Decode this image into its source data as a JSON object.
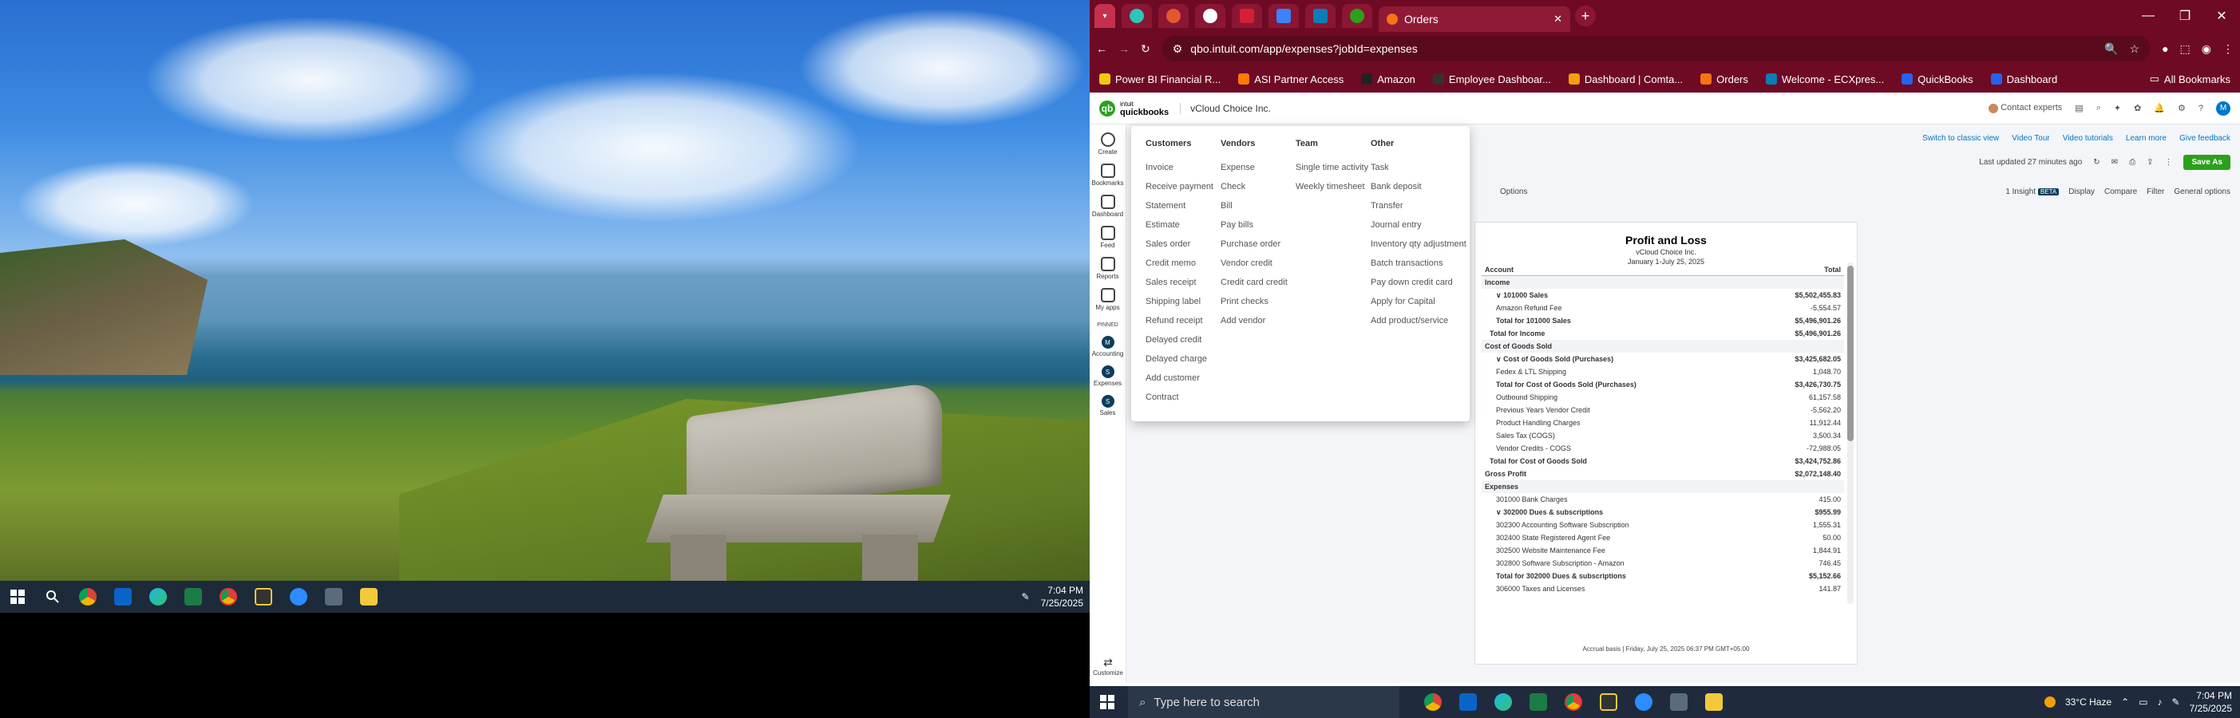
{
  "left_monitor": {
    "taskbar": {
      "icons": [
        "windows-start-icon",
        "search-icon",
        "chrome-icon",
        "outlook-icon",
        "edge-icon",
        "excel-icon",
        "chrome-profile-icon",
        "sticky-icon",
        "zoom-icon",
        "calculator-icon",
        "file-explorer-icon"
      ],
      "time": "7:04 PM",
      "date": "7/25/2025"
    }
  },
  "browser": {
    "active_tab_title": "Orders",
    "url": "qbo.intuit.com/app/expenses?jobId=expenses",
    "bookmarks": [
      "Power BI Financial R...",
      "ASI Partner Access",
      "Amazon",
      "Employee Dashboar...",
      "Dashboard | Comta...",
      "Orders",
      "Welcome - ECXpres...",
      "QuickBooks",
      "Dashboard"
    ],
    "all_bookmarks": "All Bookmarks"
  },
  "qbo": {
    "logo_top": "intuit",
    "logo_bottom": "quickbooks",
    "company": "vCloud Choice Inc.",
    "contact_experts": "Contact experts",
    "avatar": "M",
    "nav": [
      {
        "label": "Create"
      },
      {
        "label": "Bookmarks"
      },
      {
        "label": "Dashboard"
      },
      {
        "label": "Feed"
      },
      {
        "label": "Reports"
      },
      {
        "label": "My apps"
      }
    ],
    "pinned_label": "PINNED",
    "pinned": [
      {
        "label": "Accounting",
        "letter": "M"
      },
      {
        "label": "Expenses",
        "letter": "S"
      },
      {
        "label": "Sales",
        "letter": "S"
      }
    ],
    "customize": "Customize",
    "create_menu": {
      "customers": {
        "head": "Customers",
        "items": [
          "Invoice",
          "Receive payment",
          "Statement",
          "Estimate",
          "Sales order",
          "Credit memo",
          "Sales receipt",
          "Shipping label",
          "Refund receipt",
          "Delayed credit",
          "Delayed charge",
          "Add customer",
          "Contract"
        ]
      },
      "vendors": {
        "head": "Vendors",
        "items": [
          "Expense",
          "Check",
          "Bill",
          "Pay bills",
          "Purchase order",
          "Vendor credit",
          "Credit card credit",
          "Print checks",
          "Add vendor"
        ]
      },
      "team": {
        "head": "Team",
        "items": [
          "Single time activity",
          "Weekly timesheet"
        ]
      },
      "other": {
        "head": "Other",
        "items": [
          "Task",
          "Bank deposit",
          "Transfer",
          "Journal entry",
          "Inventory qty adjustment",
          "Batch transactions",
          "Pay down credit card",
          "Apply for Capital",
          "Add product/service"
        ]
      }
    },
    "toolbar": {
      "switch_classic": "Switch to classic view",
      "video_tour": "Video Tour",
      "video_tutorials": "Video tutorials",
      "learn_more": "Learn more",
      "give_feedback": "Give feedback",
      "last_updated": "Last updated 27 minutes ago",
      "save_as": "Save As",
      "options": "Options",
      "insight": "1 Insight",
      "insight_badge": "BETA",
      "display": "Display",
      "compare": "Compare",
      "filter": "Filter",
      "general_options": "General options"
    },
    "report": {
      "title": "Profit and Loss",
      "company": "vCloud Choice Inc.",
      "period": "January 1-July 25, 2025",
      "col_account": "Account",
      "col_total": "Total",
      "rows": [
        {
          "label": "Income",
          "value": "",
          "style": "sec"
        },
        {
          "label": "∨ 101000 Sales",
          "value": "$5,502,455.83",
          "style": "b"
        },
        {
          "label": "Amazon Refund Fee",
          "value": "-5,554.57",
          "style": ""
        },
        {
          "label": "Total for 101000 Sales",
          "value": "$5,496,901.26",
          "style": "b"
        },
        {
          "label": "Total for Income",
          "value": "$5,496,901.26",
          "style": "b"
        },
        {
          "label": "Cost of Goods Sold",
          "value": "",
          "style": "sec"
        },
        {
          "label": "∨ Cost of Goods Sold (Purchases)",
          "value": "$3,425,682.05",
          "style": "b"
        },
        {
          "label": "Fedex & LTL Shipping",
          "value": "1,048.70",
          "style": ""
        },
        {
          "label": "Total for Cost of Goods Sold (Purchases)",
          "value": "$3,426,730.75",
          "style": "b"
        },
        {
          "label": "Outbound Shipping",
          "value": "61,157.58",
          "style": ""
        },
        {
          "label": "Previous Years Vendor Credit",
          "value": "-5,562.20",
          "style": ""
        },
        {
          "label": "Product Handling Charges",
          "value": "11,912.44",
          "style": ""
        },
        {
          "label": "Sales Tax (COGS)",
          "value": "3,500.34",
          "style": ""
        },
        {
          "label": "Vendor Credits - COGS",
          "value": "-72,988.05",
          "style": ""
        },
        {
          "label": "Total for Cost of Goods Sold",
          "value": "$3,424,752.86",
          "style": "b"
        },
        {
          "label": "Gross Profit",
          "value": "$2,072,148.40",
          "style": "b"
        },
        {
          "label": "Expenses",
          "value": "",
          "style": "sec"
        },
        {
          "label": "301000 Bank Charges",
          "value": "415.00",
          "style": ""
        },
        {
          "label": "∨ 302000 Dues & subscriptions",
          "value": "$955.99",
          "style": "b"
        },
        {
          "label": "302300 Accounting Software Subscription",
          "value": "1,555.31",
          "style": ""
        },
        {
          "label": "302400 State Registered Agent Fee",
          "value": "50.00",
          "style": ""
        },
        {
          "label": "302500 Website Maintenance Fee",
          "value": "1,844.91",
          "style": ""
        },
        {
          "label": "302800 Software Subscription - Amazon",
          "value": "746.45",
          "style": ""
        },
        {
          "label": "Total for 302000 Dues & subscriptions",
          "value": "$5,152.66",
          "style": "b"
        },
        {
          "label": "306000 Taxes and Licenses",
          "value": "141.87",
          "style": ""
        }
      ],
      "footer": "Accrual basis  |  Friday, July 25, 2025 06:37 PM GMT+05:00"
    }
  },
  "right_taskbar": {
    "search_placeholder": "Type here to search",
    "weather": "33°C  Haze",
    "time": "7:04 PM",
    "date": "7/25/2025"
  },
  "colors": {
    "browser_chrome": "#6f0a24",
    "qb_green": "#2ca01c",
    "link_blue": "#0077c5"
  }
}
